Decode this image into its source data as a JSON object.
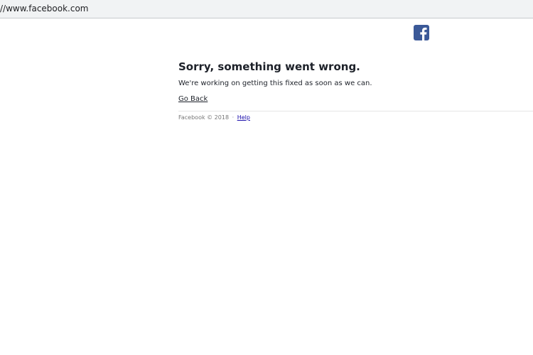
{
  "browser": {
    "address": "//www.facebook.com"
  },
  "brand": {
    "logo_icon": "facebook-logo-icon",
    "color": "#3b5998"
  },
  "error": {
    "title": "Sorry, something went wrong.",
    "message": "We're working on getting this fixed as soon as we can.",
    "go_back_label": "Go Back"
  },
  "footer": {
    "copyright": "Facebook © 2018",
    "separator": "·",
    "help_label": "Help"
  }
}
